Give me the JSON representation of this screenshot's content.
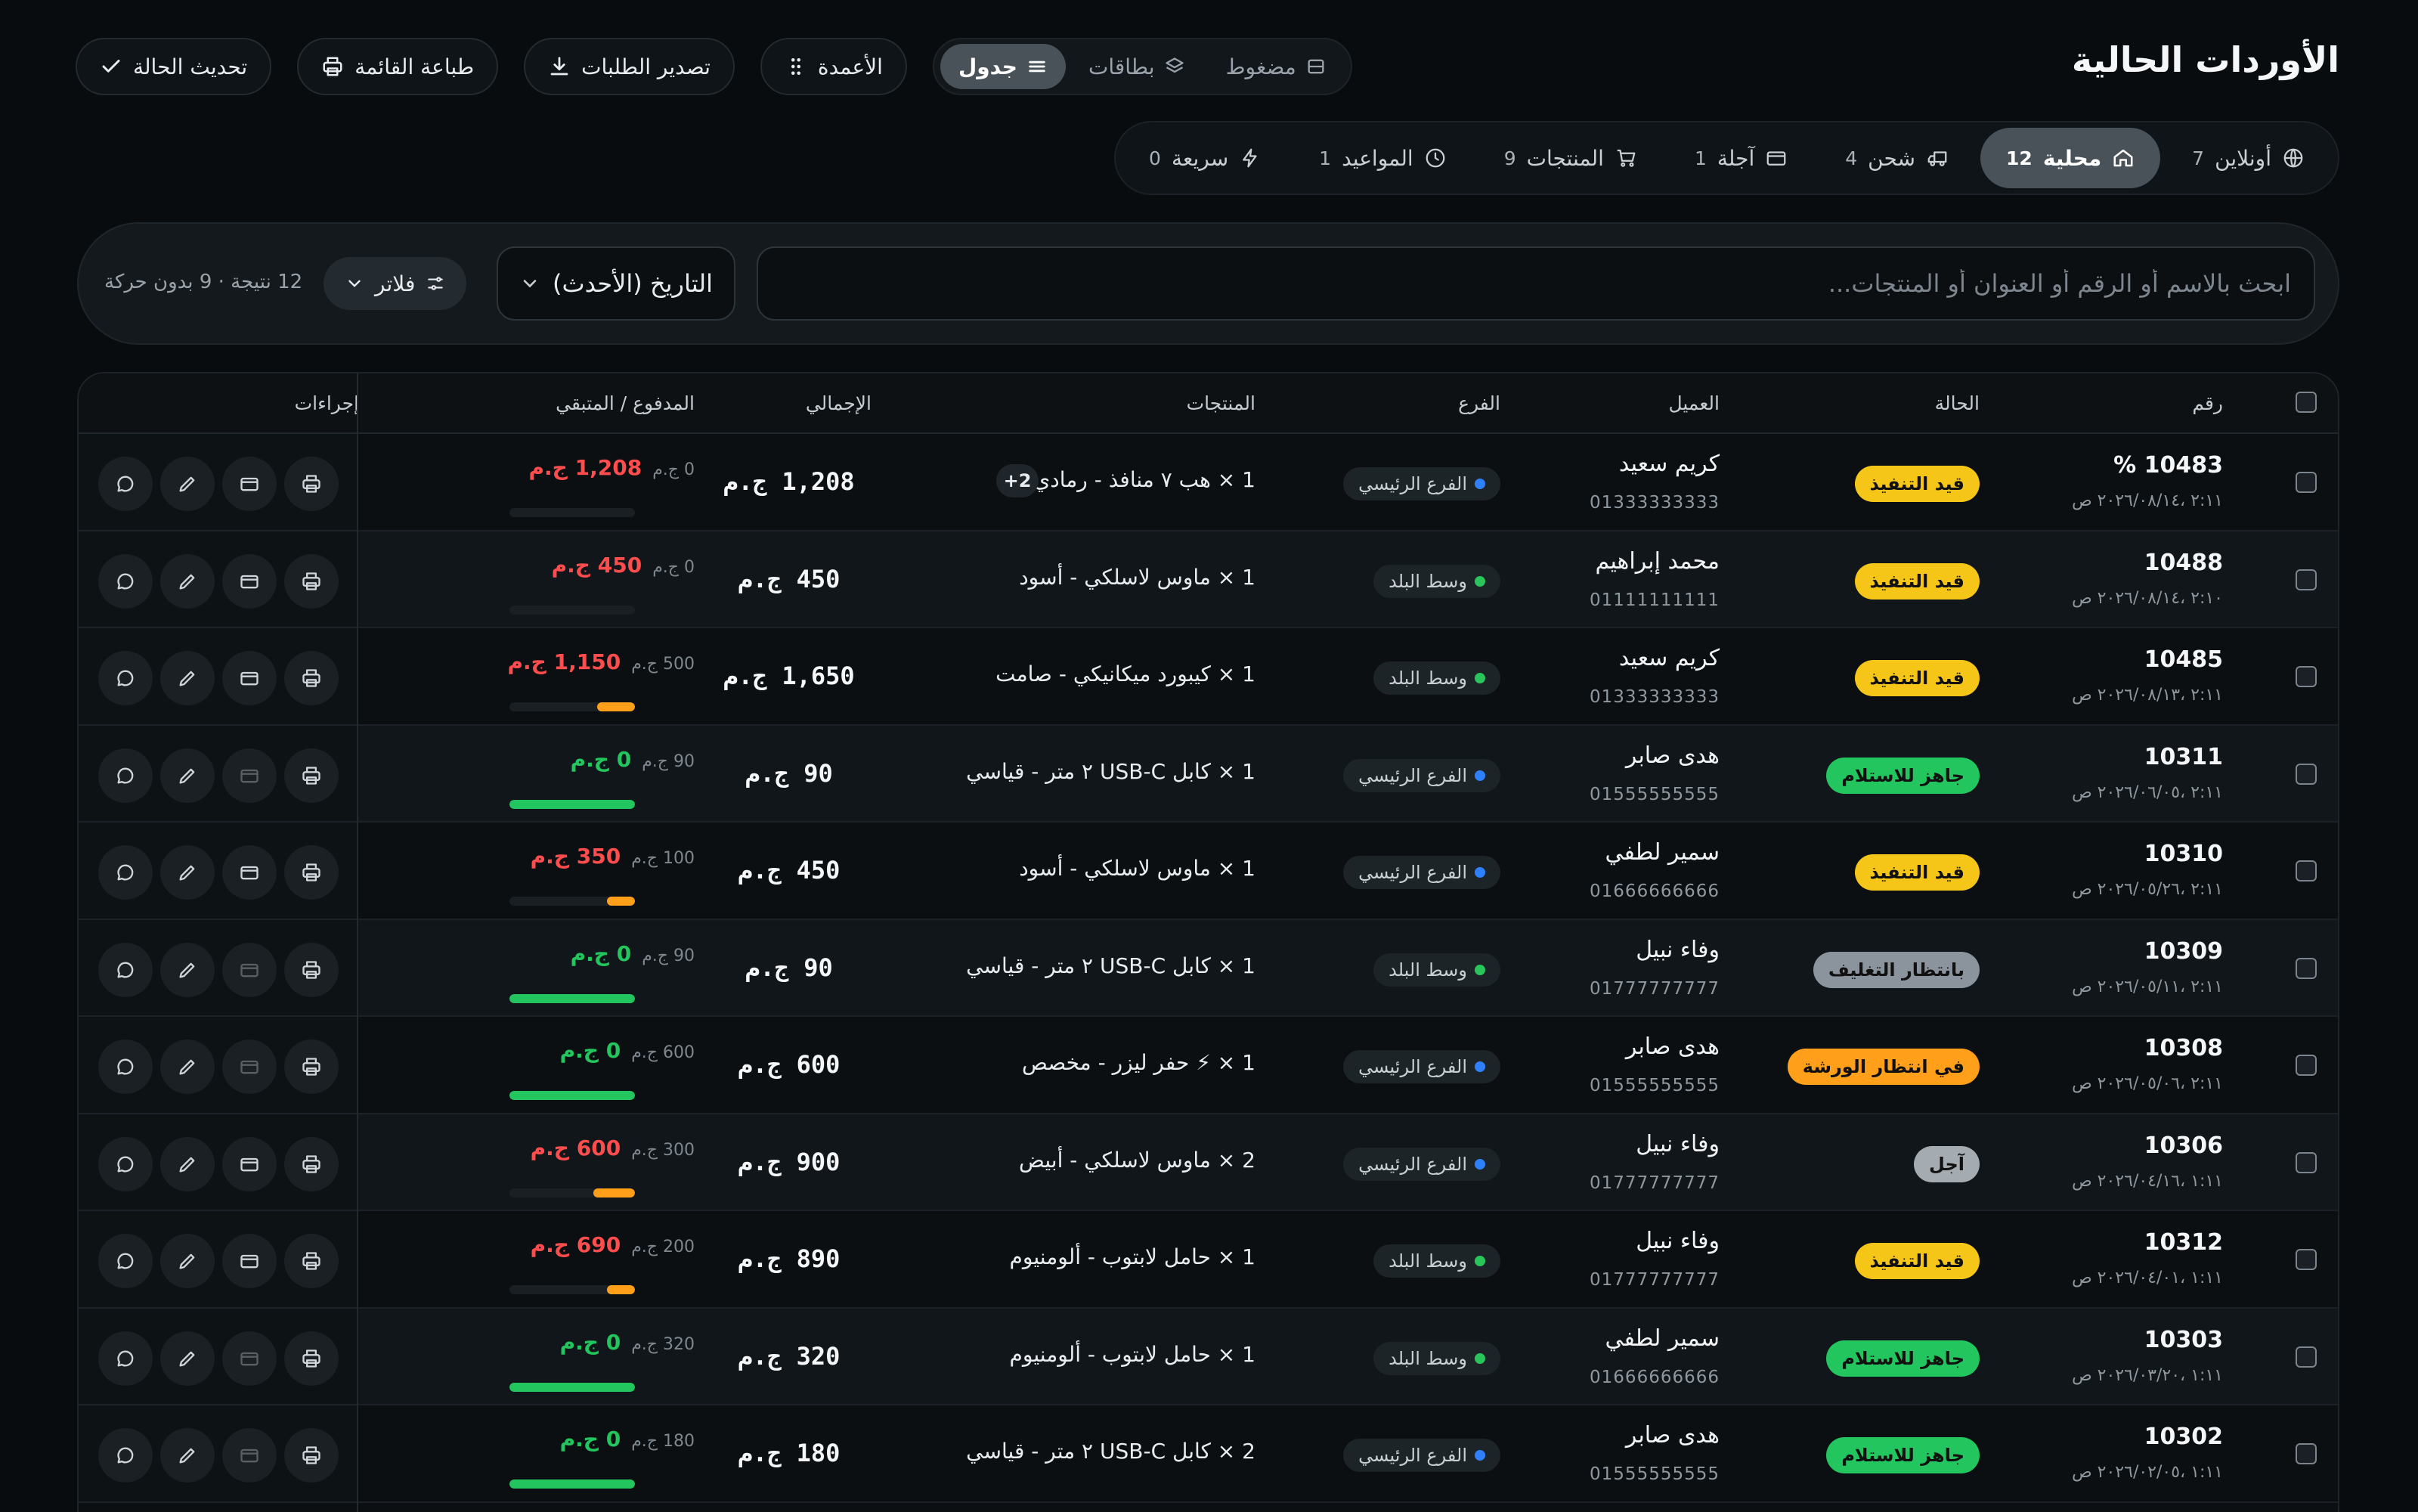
{
  "header": {
    "title": "الأوردات الحالية"
  },
  "toolbar": {
    "refresh": "تحديث الحالة",
    "print": "طباعة القائمة",
    "export": "تصدير الطلبات",
    "columns": "الأعمدة",
    "views": [
      "جدول",
      "بطاقات",
      "مضغوط"
    ],
    "active_view": "جدول"
  },
  "tabs": [
    {
      "label": "أونلاين",
      "count": "7",
      "icon": "globe-icon"
    },
    {
      "label": "محلية",
      "count": "12",
      "icon": "home-icon",
      "active": true
    },
    {
      "label": "شحن",
      "count": "4",
      "icon": "truck-icon"
    },
    {
      "label": "آجلة",
      "count": "1",
      "icon": "wallet-icon"
    },
    {
      "label": "المنتجات",
      "count": "9",
      "icon": "cart-icon"
    },
    {
      "label": "المواعيد",
      "count": "1",
      "icon": "clock-icon"
    },
    {
      "label": "سريعة",
      "count": "0",
      "icon": "bolt-icon"
    }
  ],
  "search": {
    "placeholder": "ابحث بالاسم أو الرقم أو العنوان أو المنتجات..."
  },
  "sort": {
    "value": "التاريخ (الأحدث)"
  },
  "filter": {
    "label": "فلاتر"
  },
  "results": {
    "text": "12 نتيجة · 9 بدون حركة"
  },
  "table": {
    "headers": {
      "number": "رقم",
      "status": "الحالة",
      "customer": "العميل",
      "branch": "الفرع",
      "products": "المنتجات",
      "total": "الإجمالي",
      "paid": "المدفوع / المتبقي",
      "actions": "إجراءات"
    },
    "rows": [
      {
        "id": "10483 %",
        "date": "٢:١١ ،٢٠٢٦/٠٨/١٤ ص",
        "status": "قيد التنفيذ",
        "status_color": "#f5c518",
        "customer": "كريم سعيد",
        "phone": "01333333333",
        "branch": "الفرع الرئيسي",
        "branch_color": "#2f80ff",
        "product": "1 × هب ٧ منافذ - رمادي",
        "more": "2+",
        "total": "1,208 ج.م",
        "paid": "0 ج.م",
        "remaining": "1,208 ج.م",
        "remaining_color": "#ff4d4d",
        "progress": 0
      },
      {
        "id": "10488",
        "date": "٢:١٠ ،٢٠٢٦/٠٨/١٤ ص",
        "status": "قيد التنفيذ",
        "status_color": "#f5c518",
        "customer": "محمد إبراهيم",
        "phone": "01111111111",
        "branch": "وسط البلد",
        "branch_color": "#29c45a",
        "product": "1 × ماوس لاسلكي - أسود",
        "total": "450 ج.م",
        "paid": "0 ج.م",
        "remaining": "450 ج.م",
        "remaining_color": "#ff4d4d",
        "progress": 0
      },
      {
        "id": "10485",
        "date": "٢:١١ ،٢٠٢٦/٠٨/١٣ ص",
        "status": "قيد التنفيذ",
        "status_color": "#f5c518",
        "customer": "كريم سعيد",
        "phone": "01333333333",
        "branch": "وسط البلد",
        "branch_color": "#29c45a",
        "product": "1 × كيبورد ميكانيكي - صامت",
        "total": "1,650 ج.م",
        "paid": "500 ج.م",
        "remaining": "1,150 ج.م",
        "remaining_color": "#ff4d4d",
        "progress": 0.3
      },
      {
        "id": "10311",
        "date": "٢:١١ ،٢٠٢٦/٠٦/٠٥ ص",
        "status": "جاهز للاستلام",
        "status_color": "#22c55e",
        "customer": "هدى صابر",
        "phone": "01555555555",
        "branch": "الفرع الرئيسي",
        "branch_color": "#2f80ff",
        "product": "1 × كابل USB-C ٢ متر - قياسي",
        "total": "90 ج.م",
        "paid": "90 ج.م",
        "remaining": "0 ج.م",
        "remaining_color": "#22c55e",
        "progress": 1
      },
      {
        "id": "10310",
        "date": "٢:١١ ،٢٠٢٦/٠٥/٢٦ ص",
        "status": "قيد التنفيذ",
        "status_color": "#f5c518",
        "customer": "سمير لطفي",
        "phone": "01666666666",
        "branch": "الفرع الرئيسي",
        "branch_color": "#2f80ff",
        "product": "1 × ماوس لاسلكي - أسود",
        "total": "450 ج.م",
        "paid": "100 ج.م",
        "remaining": "350 ج.م",
        "remaining_color": "#ff4d4d",
        "progress": 0.22
      },
      {
        "id": "10309",
        "date": "٢:١١ ،٢٠٢٦/٠٥/١١ ص",
        "status": "بانتظار التغليف",
        "status_color": "#8b949c",
        "customer": "وفاء نبيل",
        "phone": "01777777777",
        "branch": "وسط البلد",
        "branch_color": "#29c45a",
        "product": "1 × كابل USB-C ٢ متر - قياسي",
        "total": "90 ج.م",
        "paid": "90 ج.م",
        "remaining": "0 ج.م",
        "remaining_color": "#22c55e",
        "progress": 1
      },
      {
        "id": "10308",
        "date": "٢:١١ ،٢٠٢٦/٠٥/٠٦ ص",
        "status": "في انتظار الورشة",
        "status_color": "#ff9f1a",
        "customer": "هدى صابر",
        "phone": "01555555555",
        "branch": "الفرع الرئيسي",
        "branch_color": "#2f80ff",
        "product": "1 × ⚡ حفر ليزر - مخصص",
        "total": "600 ج.م",
        "paid": "600 ج.م",
        "remaining": "0 ج.م",
        "remaining_color": "#22c55e",
        "progress": 1
      },
      {
        "id": "10306",
        "date": "١:١١ ،٢٠٢٦/٠٤/١٦ ص",
        "status": "آجل",
        "status_color": "#a4abb1",
        "customer": "وفاء نبيل",
        "phone": "01777777777",
        "branch": "الفرع الرئيسي",
        "branch_color": "#2f80ff",
        "product": "2 × ماوس لاسلكي - أبيض",
        "total": "900 ج.م",
        "paid": "300 ج.م",
        "remaining": "600 ج.م",
        "remaining_color": "#ff4d4d",
        "progress": 0.33
      },
      {
        "id": "10312",
        "date": "١:١١ ،٢٠٢٦/٠٤/٠١ ص",
        "status": "قيد التنفيذ",
        "status_color": "#f5c518",
        "customer": "وفاء نبيل",
        "phone": "01777777777",
        "branch": "وسط البلد",
        "branch_color": "#29c45a",
        "product": "1 × حامل لابتوب - ألومنيوم",
        "total": "890 ج.م",
        "paid": "200 ج.م",
        "remaining": "690 ج.م",
        "remaining_color": "#ff4d4d",
        "progress": 0.22
      },
      {
        "id": "10303",
        "date": "١:١١ ،٢٠٢٦/٠٣/٢٠ ص",
        "status": "جاهز للاستلام",
        "status_color": "#22c55e",
        "customer": "سمير لطفي",
        "phone": "01666666666",
        "branch": "وسط البلد",
        "branch_color": "#29c45a",
        "product": "1 × حامل لابتوب - ألومنيوم",
        "total": "320 ج.م",
        "paid": "320 ج.م",
        "remaining": "0 ج.م",
        "remaining_color": "#22c55e",
        "progress": 1
      },
      {
        "id": "10302",
        "date": "١:١١ ،٢٠٢٦/٠٢/٠٥ ص",
        "status": "جاهز للاستلام",
        "status_color": "#22c55e",
        "customer": "هدى صابر",
        "phone": "01555555555",
        "branch": "الفرع الرئيسي",
        "branch_color": "#2f80ff",
        "product": "2 × كابل USB-C ٢ متر - قياسي",
        "total": "180 ج.م",
        "paid": "180 ج.م",
        "remaining": "0 ج.م",
        "remaining_color": "#22c55e",
        "progress": 1
      }
    ]
  },
  "colors": {
    "orange_progress": "#ff9f1a",
    "green_progress": "#22c55e",
    "accent_tab": "#4a5259"
  }
}
